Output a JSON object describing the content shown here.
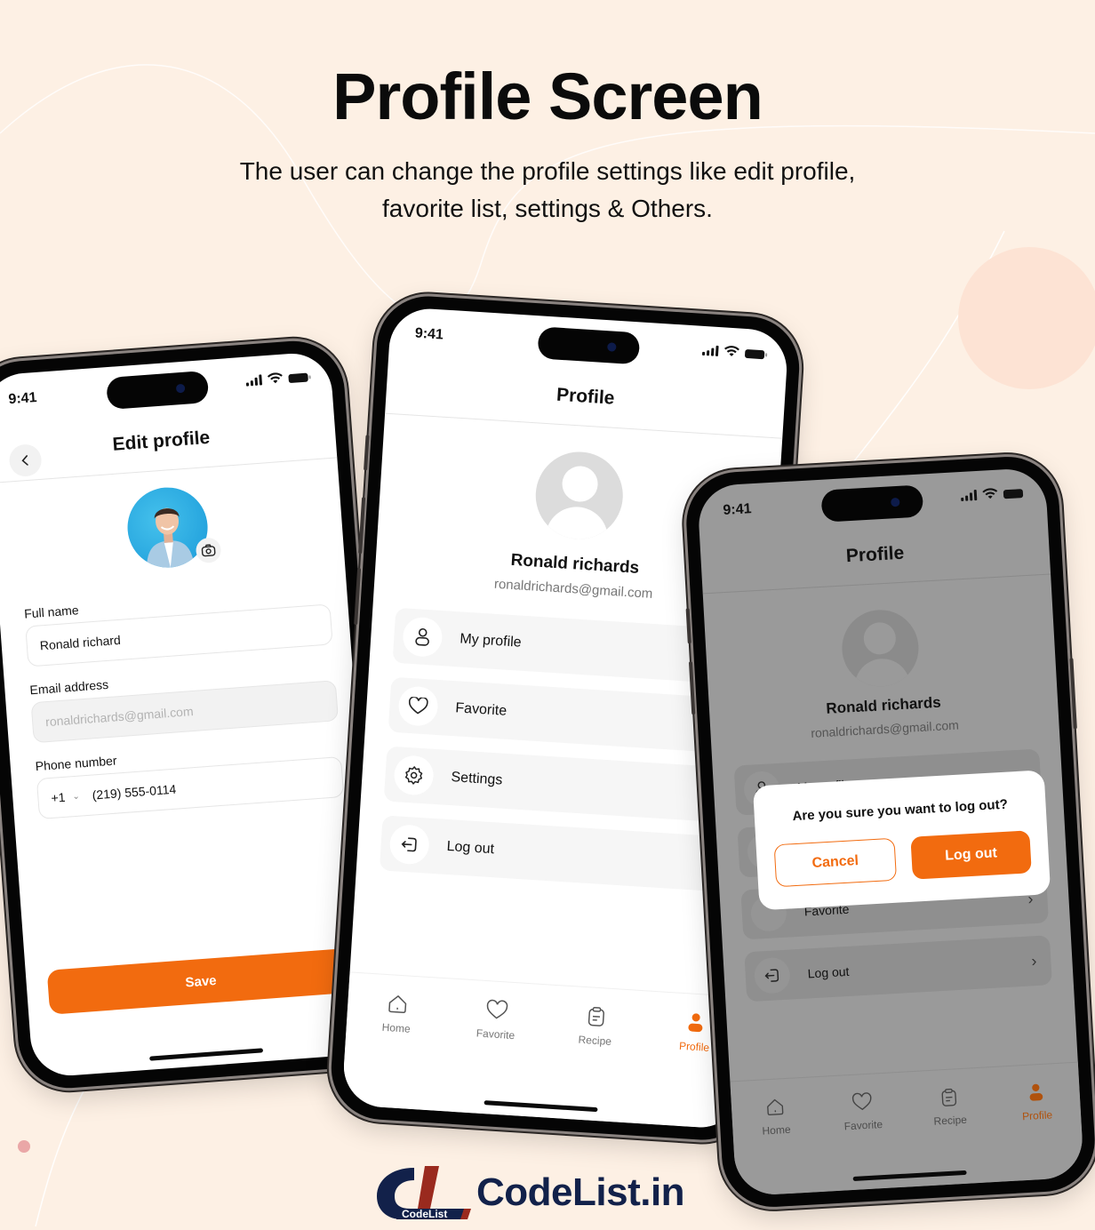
{
  "header": {
    "title": "Profile Screen",
    "subtitle_lines": [
      "The user can change the profile settings like edit profile,",
      "favorite list, settings & Others."
    ]
  },
  "colors": {
    "background": "#fdf0e4",
    "accent": "#f26b0f",
    "dim_overlay": "#9a9a9a"
  },
  "status_bar": {
    "time": "9:41",
    "icons": [
      "cellular-signal-icon",
      "wifi-icon",
      "battery-icon"
    ]
  },
  "edit_profile": {
    "title": "Edit profile",
    "back_icon": "chevron-left-icon",
    "camera_icon": "camera-icon",
    "fields": {
      "full_name": {
        "label": "Full name",
        "value": "Ronald richard"
      },
      "email": {
        "label": "Email address",
        "value": "ronaldrichards@gmail.com",
        "disabled": true
      },
      "phone": {
        "label": "Phone number",
        "country_code": "+1",
        "value": "(219) 555-0114"
      }
    },
    "save_label": "Save"
  },
  "profile": {
    "title": "Profile",
    "name": "Ronald richards",
    "email": "ronaldrichards@gmail.com",
    "menu": [
      {
        "label": "My profile",
        "icon": "user-icon"
      },
      {
        "label": "Favorite",
        "icon": "heart-icon"
      },
      {
        "label": "Settings",
        "icon": "gear-icon"
      },
      {
        "label": "Log out",
        "icon": "logout-icon"
      }
    ]
  },
  "tabbar": {
    "tabs": [
      {
        "label": "Home",
        "icon": "home-icon",
        "active": false
      },
      {
        "label": "Favorite",
        "icon": "heart-icon",
        "active": false
      },
      {
        "label": "Recipe",
        "icon": "clipboard-icon",
        "active": false
      },
      {
        "label": "Profile",
        "icon": "user-filled-icon",
        "active": true
      }
    ]
  },
  "logout_dialog": {
    "question": "Are you sure you want to log out?",
    "cancel_label": "Cancel",
    "confirm_label": "Log out"
  },
  "brand": {
    "mark_text": "CodeList",
    "name": "CodeList.in"
  }
}
